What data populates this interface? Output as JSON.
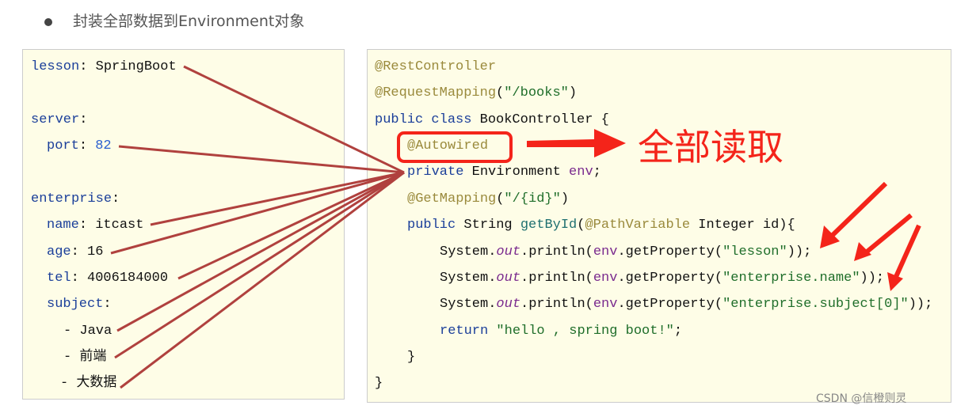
{
  "heading": "封装全部数据到Environment对象",
  "yaml": {
    "lesson_key": "lesson",
    "lesson_val": "SpringBoot",
    "server_key": "server",
    "port_key": "port",
    "port_val": "82",
    "enterprise_key": "enterprise",
    "name_key": "name",
    "name_val": "itcast",
    "age_key": "age",
    "age_val": "16",
    "tel_key": "tel",
    "tel_val": "4006184000",
    "subject_key": "subject",
    "subjects": [
      "Java",
      "前端",
      "大数据"
    ]
  },
  "java": {
    "l1": "@RestController",
    "l2a": "@RequestMapping",
    "l2b": "\"/books\"",
    "l3a": "public class",
    "l3b": " BookController {",
    "l4": "@Autowired",
    "l5a": "private",
    "l5b": " Environment ",
    "l5c": "env",
    "l5d": ";",
    "l6a": "@GetMapping",
    "l6b": "\"/{id}\"",
    "l7a": "public",
    "l7b": " String ",
    "l7c": "getById",
    "l7d": "@PathVariable",
    "l7e": " Integer id){",
    "sys": "System.",
    "out": "out",
    "println": ".println(",
    "env": "env",
    ".getProperty": ".getProperty(",
    "p1": "\"lesson\"",
    "p2": "\"enterprise.name\"",
    "p3": "\"enterprise.subject[0]\"",
    "ret_kw": "return",
    "ret_val": "\"hello , spring boot!\"",
    "close1": "}",
    "close2": "}"
  },
  "annotation": "全部读取",
  "watermark": "CSDN @信橙则灵",
  "colors": {
    "connector": "#b0413e",
    "highlight": "#f4241a",
    "panel": "#fefde7"
  }
}
